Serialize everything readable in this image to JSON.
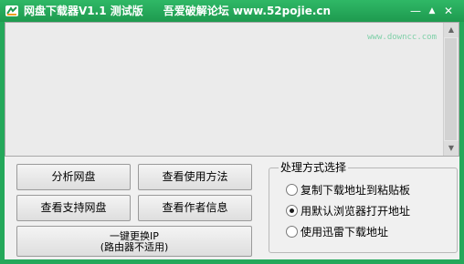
{
  "window": {
    "title": "网盘下载器V1.1 测试版",
    "subtitle": "吾爱破解论坛 www.52pojie.cn",
    "controls": [
      "—",
      "▲",
      "✕"
    ]
  },
  "output": {
    "watermark": "www.downcc.com"
  },
  "buttons": {
    "analyze": "分析网盘",
    "usage": "查看使用方法",
    "supported": "查看支持网盘",
    "author": "查看作者信息",
    "change_ip_line1": "一键更换IP",
    "change_ip_line2": "(路由器不适用)"
  },
  "processing": {
    "legend": "处理方式选择",
    "options": [
      {
        "label": "复制下载地址到粘贴板",
        "checked": false
      },
      {
        "label": "用默认浏览器打开地址",
        "checked": true
      },
      {
        "label": "使用迅雷下载地址",
        "checked": false
      }
    ]
  },
  "colors": {
    "titlebar": "#24a85a",
    "panel": "#f0f0f0",
    "output_bg": "#ebebeb"
  }
}
